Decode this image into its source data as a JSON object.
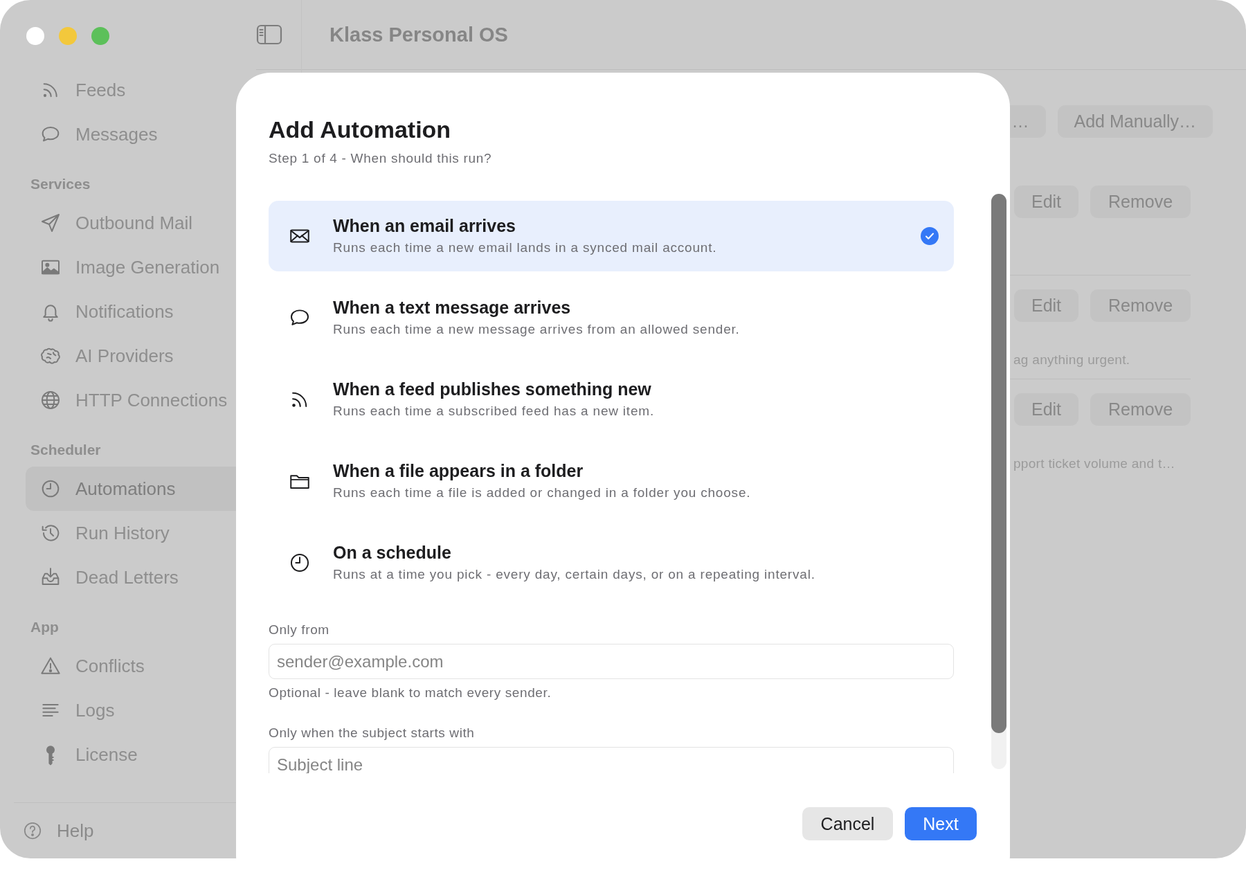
{
  "window": {
    "title": "Klass Personal OS"
  },
  "sidebar": {
    "sections": [
      {
        "items": [
          {
            "label": "Feeds",
            "selected": false
          },
          {
            "label": "Messages",
            "selected": false
          }
        ]
      },
      {
        "heading": "Services",
        "items": [
          {
            "label": "Outbound Mail",
            "selected": false
          },
          {
            "label": "Image Generation",
            "selected": false
          },
          {
            "label": "Notifications",
            "selected": false
          },
          {
            "label": "AI Providers",
            "selected": false
          },
          {
            "label": "HTTP Connections",
            "selected": false
          }
        ]
      },
      {
        "heading": "Scheduler",
        "items": [
          {
            "label": "Automations",
            "selected": true
          },
          {
            "label": "Run History",
            "selected": false
          },
          {
            "label": "Dead Letters",
            "selected": false
          }
        ]
      },
      {
        "heading": "App",
        "items": [
          {
            "label": "Conflicts",
            "selected": false
          },
          {
            "label": "Logs",
            "selected": false
          },
          {
            "label": "License",
            "selected": false
          }
        ]
      }
    ],
    "footer": {
      "label": "Help"
    }
  },
  "main": {
    "toolbar_buttons": [
      "…",
      "Add Manually…"
    ],
    "rows": [
      {
        "buttons": [
          "Edit",
          "Remove"
        ]
      },
      {
        "buttons": [
          "Edit",
          "Remove"
        ],
        "note": "ag anything urgent."
      },
      {
        "buttons": [
          "Edit",
          "Remove"
        ],
        "note": "pport ticket volume and t…"
      }
    ]
  },
  "dialog": {
    "title": "Add Automation",
    "subtitle": "Step 1 of 4 - When should this run?",
    "options": [
      {
        "title": "When an email arrives",
        "description": "Runs each time a new email lands in a synced mail account.",
        "selected": true
      },
      {
        "title": "When a text message arrives",
        "description": "Runs each time a new message arrives from an allowed sender.",
        "selected": false
      },
      {
        "title": "When a feed publishes something new",
        "description": "Runs each time a subscribed feed has a new item.",
        "selected": false
      },
      {
        "title": "When a file appears in a folder",
        "description": "Runs each time a file is added or changed in a folder you choose.",
        "selected": false
      },
      {
        "title": "On a schedule",
        "description": "Runs at a time you pick - every day, certain days, or on a repeating interval.",
        "selected": false
      }
    ],
    "fields": [
      {
        "label": "Only from",
        "placeholder": "sender@example.com",
        "hint": "Optional - leave blank to match every sender."
      },
      {
        "label": "Only when the subject starts with",
        "placeholder": "Subject line"
      }
    ],
    "buttons": [
      {
        "label": "Cancel",
        "kind": "secondary"
      },
      {
        "label": "Next",
        "kind": "primary"
      }
    ]
  }
}
